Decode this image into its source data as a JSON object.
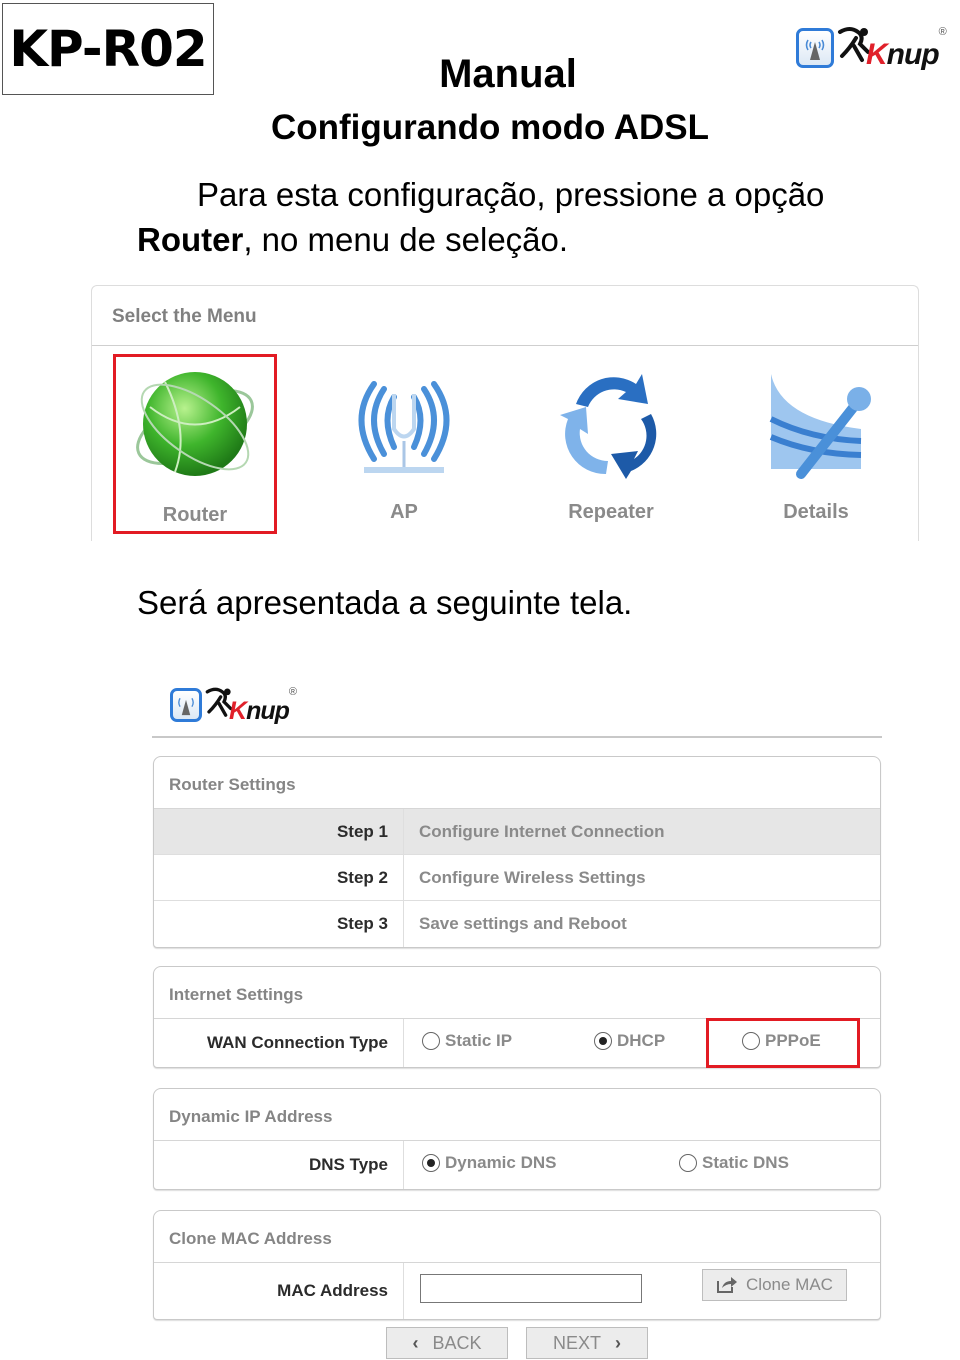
{
  "header": {
    "model": "KP-R02",
    "title": "Manual",
    "subtitle": "Configurando modo ADSL"
  },
  "brand": {
    "name_prefix": "K",
    "name_rest": "nup",
    "registered": "®"
  },
  "intro": {
    "line1": "Para esta configuração, pressione a opção",
    "bold_word": "Router",
    "line2_rest": ", no menu de seleção."
  },
  "select_menu": {
    "heading": "Select the Menu",
    "items": [
      {
        "label": "Router",
        "icon": "globe-icon",
        "selected": true
      },
      {
        "label": "AP",
        "icon": "antenna-icon",
        "selected": false
      },
      {
        "label": "Repeater",
        "icon": "repeat-arrows-icon",
        "selected": false
      },
      {
        "label": "Details",
        "icon": "tools-icon",
        "selected": false
      }
    ]
  },
  "subtext": "Será apresentada a seguinte tela.",
  "router_settings": {
    "heading": "Router Settings",
    "steps": [
      {
        "step": "Step 1",
        "desc": "Configure Internet Connection",
        "active": true
      },
      {
        "step": "Step 2",
        "desc": "Configure Wireless Settings",
        "active": false
      },
      {
        "step": "Step 3",
        "desc": "Save settings and Reboot",
        "active": false
      }
    ]
  },
  "internet_settings": {
    "heading": "Internet Settings",
    "wan_label": "WAN Connection Type",
    "options": [
      {
        "label": "Static IP",
        "checked": false
      },
      {
        "label": "DHCP",
        "checked": true
      },
      {
        "label": "PPPoE",
        "checked": false,
        "highlighted": true
      }
    ]
  },
  "dynamic_ip": {
    "heading": "Dynamic IP Address",
    "dns_label": "DNS Type",
    "options": [
      {
        "label": "Dynamic DNS",
        "checked": true
      },
      {
        "label": "Static DNS",
        "checked": false
      }
    ]
  },
  "clone_mac": {
    "heading": "Clone MAC Address",
    "mac_label": "MAC Address",
    "mac_value": "",
    "clone_button": "Clone MAC"
  },
  "nav": {
    "back": "BACK",
    "next": "NEXT",
    "back_chevron": "‹",
    "next_chevron": "›"
  },
  "colors": {
    "highlight": "#e21b23",
    "brand_red": "#e0202a",
    "brand_blue": "#2f7bd8"
  }
}
